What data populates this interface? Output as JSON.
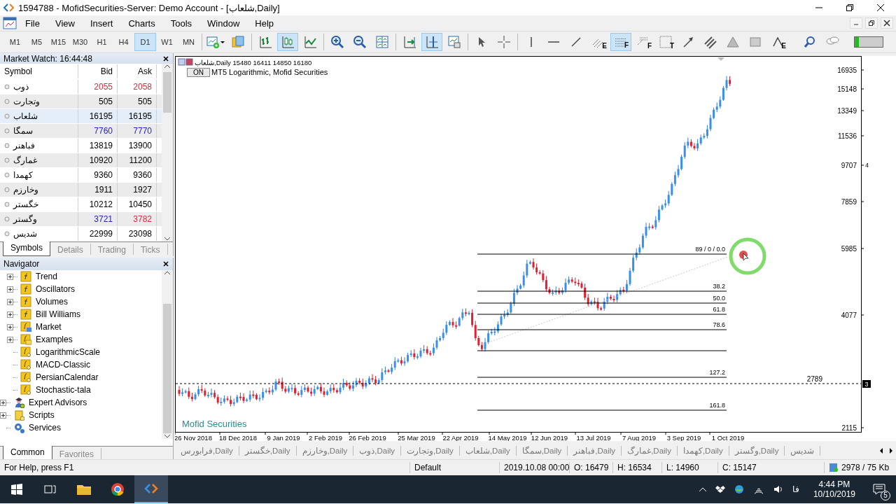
{
  "window": {
    "title": "1594788 - MofidSecurities-Server: Demo Account - [شلعاب,Daily]"
  },
  "menu": [
    "File",
    "View",
    "Insert",
    "Charts",
    "Tools",
    "Window",
    "Help"
  ],
  "toolbar": {
    "timeframes": [
      {
        "label": "M1",
        "selected": false
      },
      {
        "label": "M5",
        "selected": false
      },
      {
        "label": "M15",
        "selected": false
      },
      {
        "label": "M30",
        "selected": false
      },
      {
        "label": "H1",
        "selected": false
      },
      {
        "label": "H4",
        "selected": false
      },
      {
        "label": "D1",
        "selected": true
      },
      {
        "label": "W1",
        "selected": false
      },
      {
        "label": "MN",
        "selected": false
      }
    ],
    "tools": [
      {
        "kind": "new-chart",
        "selected": false
      },
      {
        "kind": "profiles",
        "selected": false
      },
      {
        "kind": "separator"
      },
      {
        "kind": "bar-chart",
        "selected": false
      },
      {
        "kind": "candles",
        "selected": true
      },
      {
        "kind": "line-chart",
        "selected": false
      },
      {
        "kind": "separator"
      },
      {
        "kind": "zoom-in",
        "selected": false
      },
      {
        "kind": "zoom-out",
        "selected": false
      },
      {
        "kind": "tile",
        "selected": false
      },
      {
        "kind": "separator"
      },
      {
        "kind": "autoscroll",
        "selected": false
      },
      {
        "kind": "chart-shift",
        "selected": true
      },
      {
        "kind": "templates",
        "selected": false
      },
      {
        "kind": "separator"
      },
      {
        "kind": "cursor",
        "selected": false
      },
      {
        "kind": "crosshair",
        "selected": false
      },
      {
        "kind": "separator"
      },
      {
        "kind": "vline",
        "selected": false
      },
      {
        "kind": "hline",
        "selected": false
      },
      {
        "kind": "trend",
        "selected": false
      },
      {
        "kind": "fib-channel",
        "badge": "E",
        "selected": false
      },
      {
        "kind": "fib-retracement",
        "badge": "F",
        "selected": true
      },
      {
        "kind": "fib-fan",
        "badge": "F",
        "selected": false
      },
      {
        "kind": "text",
        "badge": "T",
        "selected": false
      },
      {
        "kind": "arrow",
        "selected": false
      },
      {
        "kind": "channel",
        "selected": false
      },
      {
        "kind": "triangle",
        "selected": false
      },
      {
        "kind": "rectangle",
        "selected": false
      },
      {
        "kind": "elliott",
        "badge": "E",
        "selected": false
      },
      {
        "kind": "search",
        "selected": false
      },
      {
        "kind": "chat",
        "selected": false
      },
      {
        "kind": "meter"
      }
    ]
  },
  "market_watch": {
    "title": "Market Watch: 16:44:48",
    "columns": [
      "Symbol",
      "Bid",
      "Ask"
    ],
    "rows": [
      {
        "symbol": "ذوب",
        "bid": {
          "value": "2055",
          "color": "#e0283a"
        },
        "ask": {
          "value": "2058",
          "color": "#e0283a"
        },
        "selected": false
      },
      {
        "symbol": "وتجارت",
        "bid": {
          "value": "505",
          "color": "#000000"
        },
        "ask": {
          "value": "505",
          "color": "#000000"
        },
        "selected": false
      },
      {
        "symbol": "شلعاب",
        "bid": {
          "value": "16195",
          "color": "#000000"
        },
        "ask": {
          "value": "16195",
          "color": "#000000"
        },
        "selected": true
      },
      {
        "symbol": "سمگا",
        "bid": {
          "value": "7760",
          "color": "#2323c8"
        },
        "ask": {
          "value": "7770",
          "color": "#2323c8"
        },
        "selected": false
      },
      {
        "symbol": "فباهنر",
        "bid": {
          "value": "13819",
          "color": "#000000"
        },
        "ask": {
          "value": "13900",
          "color": "#000000"
        },
        "selected": false
      },
      {
        "symbol": "غمارگ",
        "bid": {
          "value": "10920",
          "color": "#000000"
        },
        "ask": {
          "value": "11200",
          "color": "#000000"
        },
        "selected": false
      },
      {
        "symbol": "کهمدا",
        "bid": {
          "value": "9360",
          "color": "#000000"
        },
        "ask": {
          "value": "9360",
          "color": "#000000"
        },
        "selected": false
      },
      {
        "symbol": "وخارزم",
        "bid": {
          "value": "1911",
          "color": "#000000"
        },
        "ask": {
          "value": "1927",
          "color": "#000000"
        },
        "selected": false
      },
      {
        "symbol": "خگستر",
        "bid": {
          "value": "10212",
          "color": "#000000"
        },
        "ask": {
          "value": "10450",
          "color": "#000000"
        },
        "selected": false
      },
      {
        "symbol": "وگستر",
        "bid": {
          "value": "3721",
          "color": "#2323c8"
        },
        "ask": {
          "value": "3782",
          "color": "#e0283a"
        },
        "selected": false
      },
      {
        "symbol": "شدیس",
        "bid": {
          "value": "22999",
          "color": "#000000"
        },
        "ask": {
          "value": "23098",
          "color": "#000000"
        },
        "selected": false
      }
    ],
    "tabs": [
      {
        "label": "Symbols",
        "selected": true
      },
      {
        "label": "Details",
        "selected": false
      },
      {
        "label": "Trading",
        "selected": false
      },
      {
        "label": "Ticks",
        "selected": false
      }
    ]
  },
  "navigator": {
    "title": "Navigator",
    "tree": [
      {
        "children": [
          {
            "label": "Trend",
            "kind": "indicator-group",
            "expanded": false
          },
          {
            "label": "Oscillators",
            "kind": "indicator-group",
            "expanded": false
          },
          {
            "label": "Volumes",
            "kind": "indicator-group",
            "expanded": false
          },
          {
            "label": "Bill Williams",
            "kind": "indicator-group",
            "expanded": false
          },
          {
            "label": "Market",
            "kind": "market",
            "expanded": false
          },
          {
            "label": "Examples",
            "kind": "examples",
            "expanded": false
          },
          {
            "label": "LogarithmicScale",
            "kind": "custom"
          },
          {
            "label": "MACD-Classic",
            "kind": "custom"
          },
          {
            "label": "PersianCalendar",
            "kind": "custom"
          },
          {
            "label": "Stochastic-tala",
            "kind": "custom"
          }
        ]
      },
      {
        "label": "Expert Advisors",
        "kind": "experts",
        "expanded": false
      },
      {
        "label": "Scripts",
        "kind": "scripts",
        "expanded": false
      },
      {
        "label": "Services",
        "kind": "services"
      }
    ],
    "tabs": [
      {
        "label": "Common",
        "selected": true
      },
      {
        "label": "Favorites",
        "selected": false
      }
    ]
  },
  "chart": {
    "header": "شلعاب,Daily  15480 16411 14850 16180",
    "indicator_button": "ON",
    "indicator_label": "MT5 Logarithmic, Mofid Securities",
    "logo_text": "Mofid Securities",
    "price_labels": [
      "16935",
      "15148",
      "13349",
      "11536",
      "9707",
      "7859",
      "5985",
      "4077",
      "2115"
    ],
    "line_price": "2789",
    "line_marker": "3",
    "axis_marker": "4",
    "date_labels": [
      "26 Nov 2018",
      "18 Dec 2018",
      "9 Jan 2019",
      "2 Feb 2019",
      "26 Feb 2019",
      "25 Mar 2019",
      "22 Apr 2019",
      "14 May 2019",
      "12 Jun 2019",
      "13 Jul 2019",
      "7 Aug 2019",
      "3 Sep 2019",
      "1 Oct 2019"
    ],
    "fib_levels": [
      "89 / 0 / 0.0",
      "38.2",
      "50.0",
      "61.8",
      "78.6",
      "127.2",
      "161.8"
    ]
  },
  "chart_tabs": [
    "فرابورس,Daily",
    "خگستر,Daily",
    "وخارزم,Daily",
    "ذوب,Daily",
    "وتجارت,Daily",
    "شلعاب,Daily",
    "سمگا,Daily",
    "فباهنر,Daily",
    "غمارگ,Daily",
    "کهمدا,Daily",
    "وگستر,Daily",
    "شدیس"
  ],
  "status_bar": {
    "help": "For Help, press F1",
    "profile": "Default",
    "time": "2019.10.08 00:00",
    "open": "O: 16479",
    "high": "H: 16534",
    "low": "L: 14960",
    "close": "C: 15147",
    "traffic": "2978 / 75 Kb"
  },
  "taskbar": {
    "language": "فا",
    "time": "4:44 PM",
    "date": "10/10/2019",
    "notifications": "5"
  }
}
